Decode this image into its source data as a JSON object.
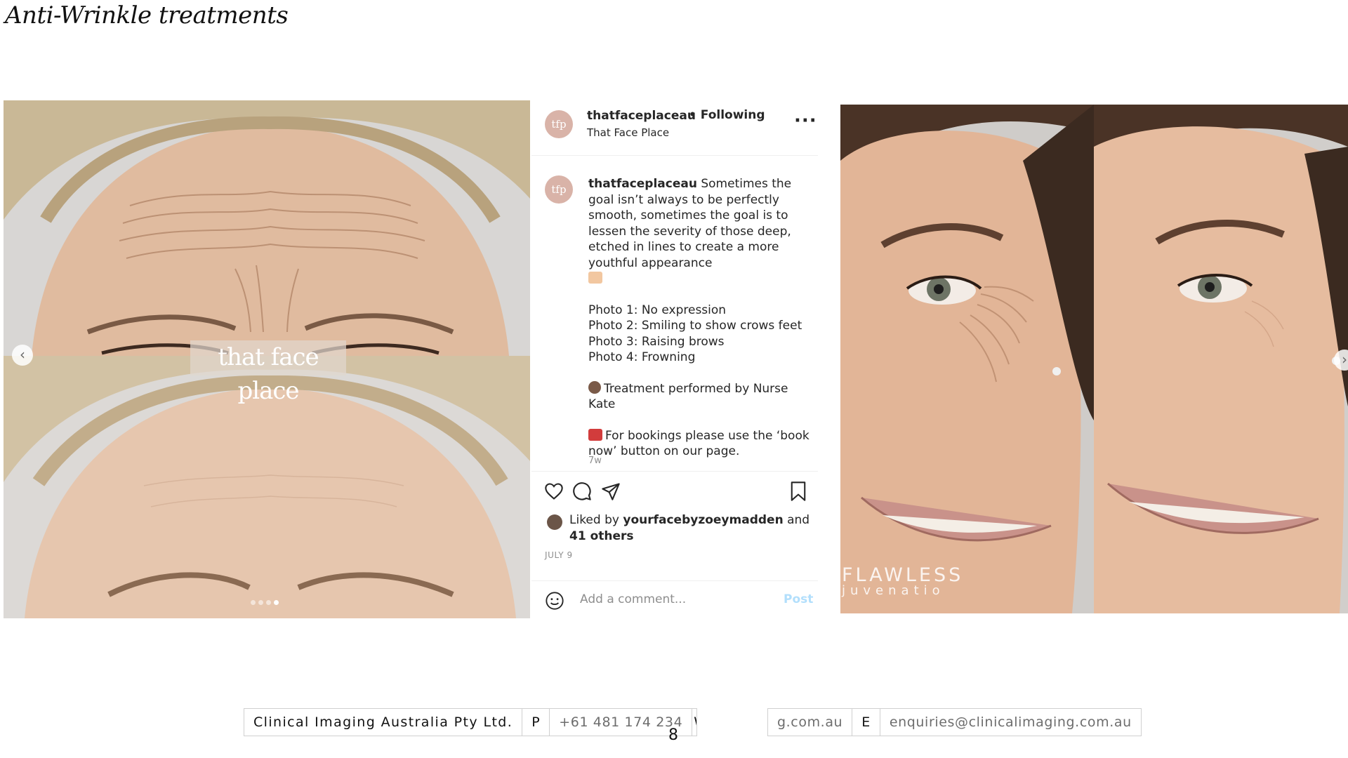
{
  "page_title": "Anti-Wrinkle treatments",
  "left_photo": {
    "watermark": "that face place",
    "arrow": "chevron-left-icon"
  },
  "instagram": {
    "username": "thatfaceplaceau",
    "follow_status": "• Following",
    "location": "That Face Place",
    "avatar_text": "tfp",
    "caption_user": "thatfaceplaceau",
    "caption_text": "Sometimes the goal isn’t always to be perfectly smooth, sometimes the goal is to lessen the severity of those deep, etched in lines to create a more youthful appearance",
    "photo_lines": [
      "Photo 1: No expression",
      "Photo 2: Smiling to show crows feet",
      "Photo 3: Raising brows",
      "Photo 4: Frowning"
    ],
    "treatment_line": "Treatment performed by Nurse Kate",
    "booking_line": "For bookings please use the ‘book now’ button on our page.",
    "time_ago": "7w",
    "liked_prefix": "Liked by",
    "liked_user": "yourfacebyzoeymadden",
    "liked_and": "and",
    "liked_others": "41 others",
    "date": "JULY 9",
    "comment_placeholder": "Add a comment...",
    "post_label": "Post"
  },
  "right_photo": {
    "brand_line1": "FLAWLESS",
    "brand_line2": "juvenatio"
  },
  "footer": {
    "company": "Clinical Imaging Australia Pty Ltd.",
    "phone_label": "P",
    "phone": "+61 481 174 234",
    "web_cut": "W",
    "web_tail": "g.com.au",
    "email_label": "E",
    "email": "enquiries@clinicalimaging.com.au"
  },
  "page_number": "8"
}
